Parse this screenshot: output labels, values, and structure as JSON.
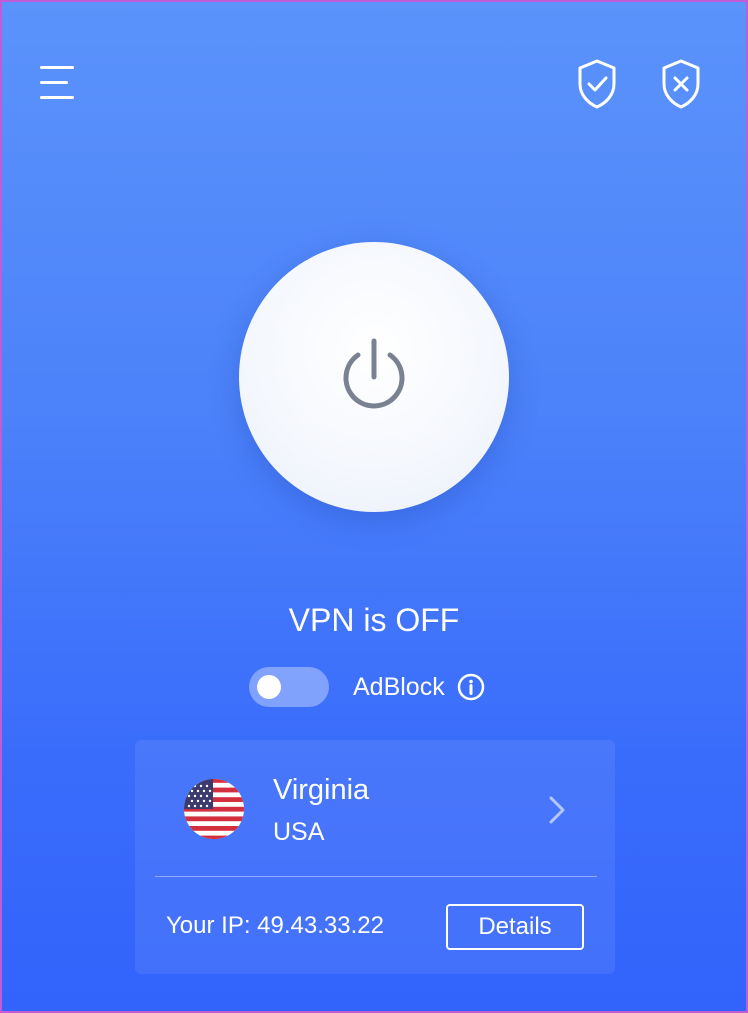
{
  "status": {
    "text": "VPN is OFF"
  },
  "adblock": {
    "label": "AdBlock",
    "enabled": false
  },
  "location": {
    "city": "Virginia",
    "country": "USA"
  },
  "connection": {
    "ip_text": "Your IP: 49.43.33.22",
    "details_label": "Details"
  },
  "icons": {
    "menu": "hamburger-menu-icon",
    "protected": "shield-check-icon",
    "unprotected": "shield-x-icon",
    "power": "power-icon",
    "info": "info-icon",
    "flag": "us-flag-icon",
    "chevron": "chevron-right-icon"
  },
  "colors": {
    "background_top": "#5b93fb",
    "background_bottom": "#3263fb",
    "power_icon": "#7a8191",
    "text": "#ffffff"
  }
}
